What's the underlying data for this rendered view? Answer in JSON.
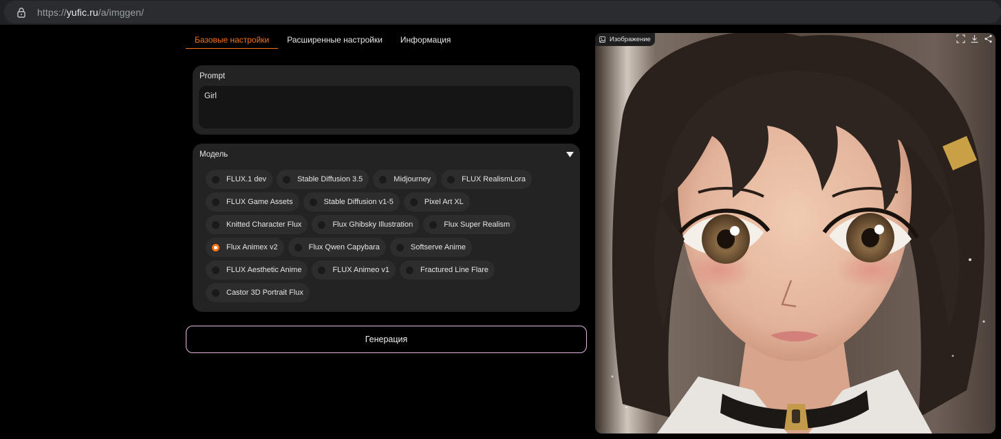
{
  "browser": {
    "url_scheme": "https://",
    "url_host": "yufic.ru",
    "url_path": "/a/imggen/"
  },
  "tabs": [
    {
      "label": "Базовые настройки",
      "active": true
    },
    {
      "label": "Расширенные настройки",
      "active": false
    },
    {
      "label": "Информация",
      "active": false
    }
  ],
  "prompt": {
    "label": "Prompt",
    "value": "Girl"
  },
  "model": {
    "label": "Модель",
    "selected": "Flux Animex v2",
    "options": [
      [
        "FLUX.1 dev",
        "Stable Diffusion 3.5",
        "Midjourney",
        "FLUX RealismLora"
      ],
      [
        "FLUX Game Assets",
        "Stable Diffusion v1-5",
        "Pixel Art XL"
      ],
      [
        "Knitted Character Flux",
        "Flux Ghibsky Illustration",
        "Flux Super Realism"
      ],
      [
        "Flux Animex v2",
        "Flux Qwen Capybara",
        "Softserve Anime"
      ],
      [
        "FLUX Aesthetic Anime",
        "FLUX Animeo v1",
        "Fractured Line Flare"
      ],
      [
        "Castor 3D Portrait Flux"
      ]
    ]
  },
  "generate_label": "Генерация",
  "image": {
    "label": "Изображение",
    "actions": [
      "fullscreen-icon",
      "download-icon",
      "share-icon"
    ]
  },
  "colors": {
    "accent": "#f97316",
    "button_border": "#e6b7e6",
    "panel": "#232323"
  }
}
